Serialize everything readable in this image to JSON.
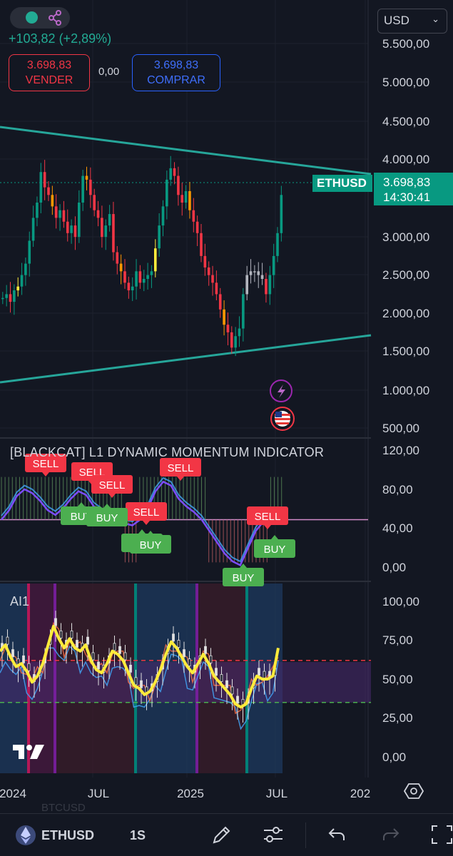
{
  "header": {
    "change": "+103,82 (+2,89%)",
    "sell_price": "3.698,83",
    "sell_label": "VENDER",
    "spread": "0,00",
    "buy_price": "3.698,83",
    "buy_label": "COMPRAR",
    "currency": "USD"
  },
  "price_axis": [
    "5.500,00",
    "5.000,00",
    "4.500,00",
    "4.000,00",
    "3.000,00",
    "2.500,00",
    "2.000,00",
    "1.500,00",
    "1.000,00",
    "500,00"
  ],
  "last_price": {
    "symbol": "ETHUSD",
    "price": "3.698,83",
    "countdown": "14:30:41"
  },
  "indicator": {
    "title": "[BLACKCAT] L1 DYNAMIC MOMENTUM INDICATOR",
    "axis": [
      "120,00",
      "80,00",
      "40,00",
      "0,00"
    ],
    "sell_label": "SELL",
    "buy_label": "BUY"
  },
  "ai": {
    "title": "AI1",
    "axis": [
      "100,00",
      "75,00",
      "50,00",
      "25,00",
      "0,00"
    ]
  },
  "time_axis": [
    "2024",
    "JUL",
    "2025",
    "JUL",
    "202"
  ],
  "ghost_symbol": "BTCUSD",
  "toolbar": {
    "symbol": "ETHUSD",
    "timeframe": "1S"
  },
  "colors": {
    "up": "#089981",
    "down": "#f23645",
    "accent": "#2962ff",
    "trendline": "#26a69a",
    "ai_line": "#ffeb3b"
  },
  "icons": [
    "share-icon",
    "flash-icon",
    "us-flag-icon",
    "chevron-down-icon",
    "eth-icon",
    "draw-icon",
    "indicators-icon",
    "undo-icon",
    "redo-icon",
    "fullscreen-icon",
    "settings-icon",
    "tradingview-logo"
  ]
}
